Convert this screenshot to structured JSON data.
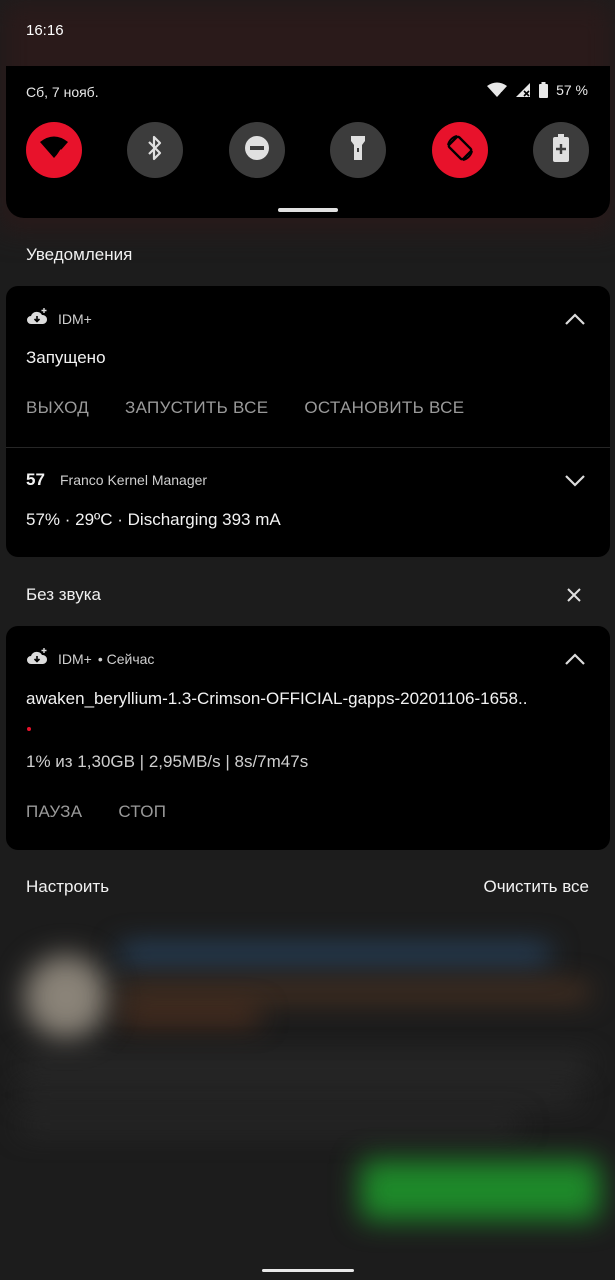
{
  "status_bar": {
    "time": "16:16"
  },
  "quick_settings": {
    "date": "Сб, 7 нояб.",
    "battery_percent": "57 %",
    "wifi_badge": "4",
    "tiles": [
      {
        "icon": "wifi-icon",
        "active": true
      },
      {
        "icon": "bluetooth-icon",
        "active": false
      },
      {
        "icon": "dnd-icon",
        "active": false
      },
      {
        "icon": "flashlight-icon",
        "active": false
      },
      {
        "icon": "auto-rotate-icon",
        "active": true
      },
      {
        "icon": "battery-saver-icon",
        "active": false
      }
    ],
    "accent_color": "#e8122b"
  },
  "sections": {
    "notifications_label": "Уведомления",
    "silent_label": "Без звука"
  },
  "notifications": {
    "idm_running": {
      "app": "IDM+",
      "title": "Запущено",
      "actions": [
        "ВЫХОД",
        "ЗАПУСТИТЬ ВСЕ",
        "ОСТАНОВИТЬ ВСЕ"
      ]
    },
    "franco": {
      "badge": "57",
      "app": "Franco Kernel Manager",
      "title": "57% · 29ºC · Discharging 393 mA"
    },
    "idm_download": {
      "app": "IDM+",
      "time": "• Сейчас",
      "title": "awaken_beryllium-1.3-Crimson-OFFICIAL-gapps-20201106-1658..",
      "progress": 0.01,
      "detail": "1% из 1,30GB | 2,95MB/s | 8s/7m47s",
      "actions": [
        "ПАУЗА",
        "СТОП"
      ]
    }
  },
  "footer": {
    "manage": "Настроить",
    "clear_all": "Очистить все"
  }
}
